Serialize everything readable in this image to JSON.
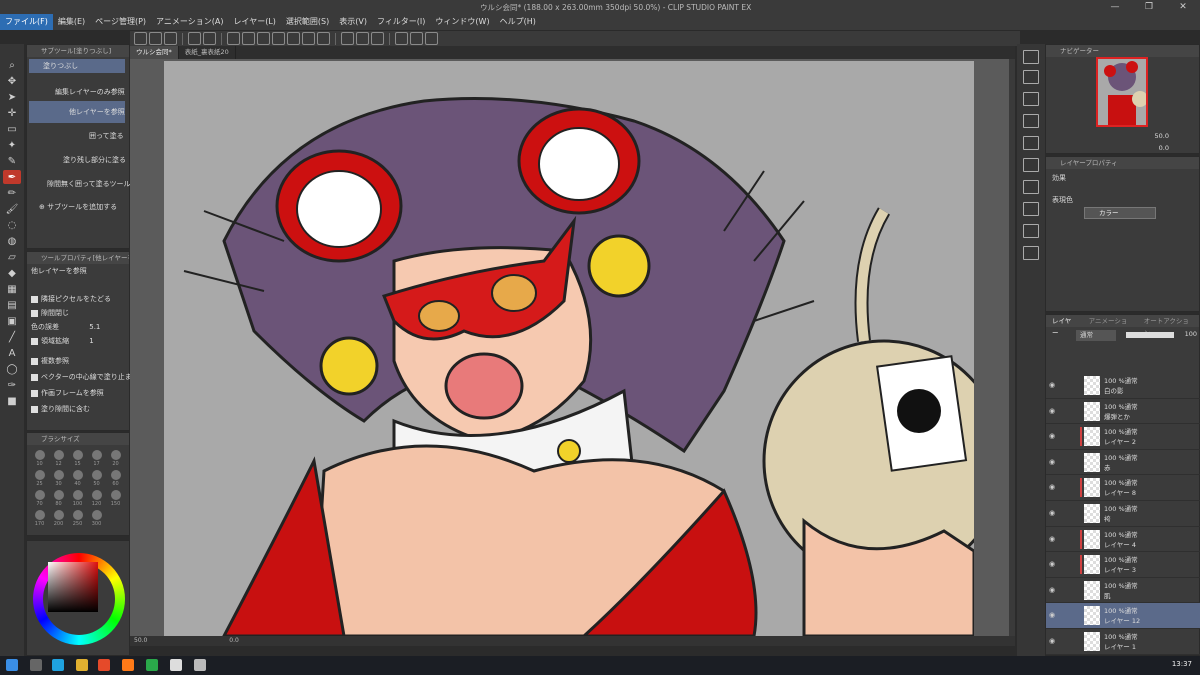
{
  "window": {
    "title": "ウルシ会同* (188.00 x 263.00mm 350dpi 50.0%)  - CLIP STUDIO PAINT EX",
    "controls": [
      "—",
      "❐",
      "✕"
    ]
  },
  "menu": [
    "ファイル(F)",
    "編集(E)",
    "ページ管理(P)",
    "アニメーション(A)",
    "レイヤー(L)",
    "選択範囲(S)",
    "表示(V)",
    "フィルター(I)",
    "ウィンドウ(W)",
    "ヘルプ(H)"
  ],
  "subtool": {
    "header": "サブツール[塗りつぶし]",
    "items": [
      "塗りつぶし",
      "編集レイヤーのみ参照",
      "他レイヤーを参照",
      "囲って塗る",
      "塗り残し部分に塗る",
      "隙間無く囲って塗るツール"
    ],
    "add_label": "サブツールを追加する"
  },
  "tool_property": {
    "header": "ツールプロパティ[他レイヤーを参照]",
    "title": "他レイヤーを参照",
    "rows": [
      "隣接ピクセルをたどる",
      "隙間閉じ",
      "色の誤差",
      "領域拡縮",
      "複数参照",
      "ベクターの中心線で塗り止まる",
      "作画フレームを参照",
      "塗り隙間に含む"
    ],
    "tolerance_value": "5.1",
    "expand_value": "1"
  },
  "brush_size": {
    "header": "ブラシサイズ",
    "sizes": [
      "10",
      "12",
      "15",
      "17",
      "20",
      "25",
      "30",
      "40",
      "50",
      "60",
      "70",
      "80",
      "100",
      "120",
      "150",
      "170",
      "200",
      "250",
      "300"
    ]
  },
  "colors": {
    "main": "#e01010",
    "accent": "#2d6db3",
    "layer_selected": "#5b6a8a"
  },
  "document": {
    "tabs": [
      "ウルシ会同*",
      "表紙_裏表紙20"
    ],
    "zoom": "50.0",
    "rotation": "0.0"
  },
  "navigator": {
    "header": "ナビゲーター",
    "zoom": "50.0",
    "angle": "0.0"
  },
  "layer_property": {
    "header": "レイヤープロパティ",
    "effect_label": "効果",
    "expression_label": "表現色",
    "expression_value": "カラー"
  },
  "layers": {
    "tabs": [
      "レイヤー",
      "アニメーション",
      "オートアクション"
    ],
    "blend_mode": "通常",
    "opacity": "100",
    "items": [
      {
        "mode": "100 %通常",
        "name": "白の影"
      },
      {
        "mode": "100 %通常",
        "name": "爆弾とか"
      },
      {
        "mode": "100 %通常",
        "name": "レイヤー 2"
      },
      {
        "mode": "100 %通常",
        "name": "赤"
      },
      {
        "mode": "100 %通常",
        "name": "レイヤー 8"
      },
      {
        "mode": "100 %通常",
        "name": "袴"
      },
      {
        "mode": "100 %通常",
        "name": "レイヤー 4"
      },
      {
        "mode": "100 %通常",
        "name": "レイヤー 3"
      },
      {
        "mode": "100 %通常",
        "name": "肌"
      },
      {
        "mode": "100 %通常",
        "name": "レイヤー 12"
      },
      {
        "mode": "100 %通常",
        "name": "レイヤー 1"
      }
    ]
  },
  "taskbar": {
    "clock": "13:37"
  }
}
